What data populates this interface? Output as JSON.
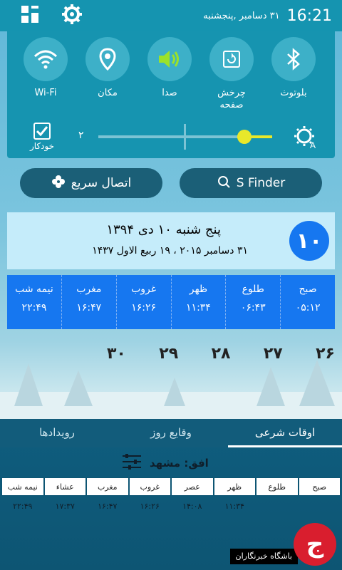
{
  "status": {
    "time": "16:21",
    "date": "۳۱ دسامبر ,پنجشنبه"
  },
  "quick_toggles": [
    {
      "label": "Wi-Fi",
      "icon": "wifi-icon"
    },
    {
      "label": "مکان",
      "icon": "location-icon"
    },
    {
      "label": "صدا",
      "icon": "sound-icon"
    },
    {
      "label": "چرخش\nصفحه",
      "icon": "rotate-icon"
    },
    {
      "label": "بلوتوث",
      "icon": "bluetooth-icon"
    }
  ],
  "brightness": {
    "auto_label": "خودکار",
    "value_label": "۲",
    "level": 0.84
  },
  "buttons": {
    "quick_connect": "اتصال سریع",
    "sfinder": "S Finder"
  },
  "date_card": {
    "day_number": "۱۰",
    "line1": "پنج شنبه ۱۰ دی ۱۳۹۴",
    "line2": "۳۱ دسامبر ۲۰۱۵ ، ۱۹ ربیع الاول ۱۴۳۷"
  },
  "prayer_times": [
    {
      "name": "صبح",
      "time": "۰۵:۱۲"
    },
    {
      "name": "طلوع",
      "time": "۰۶:۴۳"
    },
    {
      "name": "ظهر",
      "time": "۱۱:۳۴"
    },
    {
      "name": "غروب",
      "time": "۱۶:۲۶"
    },
    {
      "name": "مغرب",
      "time": "۱۶:۴۷"
    },
    {
      "name": "نیمه شب",
      "time": "۲۲:۴۹"
    }
  ],
  "calendar_numbers": [
    "۲۶",
    "۲۷",
    "۲۸",
    "۲۹",
    "۳۰"
  ],
  "tabs": [
    "اوقات شرعی",
    "وقایع روز",
    "رویدادها"
  ],
  "horizon_label": "افق: مشهد",
  "table_headers": [
    "صبح",
    "طلوع",
    "ظهر",
    "عصر",
    "غروب",
    "مغرب",
    "عشاء",
    "نیمه شب"
  ],
  "table_times": [
    "",
    "",
    "۱۱:۳۴",
    "۱۴:۰۸",
    "۱۶:۲۶",
    "۱۶:۴۷",
    "۱۷:۳۷",
    "۲۲:۴۹"
  ],
  "watermark": "باشگاه خبرنگاران"
}
